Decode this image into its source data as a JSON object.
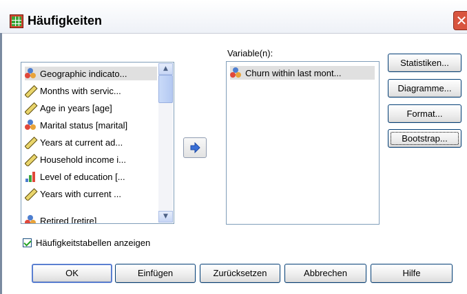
{
  "dialog": {
    "title": "Häufigkeiten",
    "close_glyph": "✕"
  },
  "source_list": {
    "items": [
      {
        "label": "Geographic indicato...",
        "icon": "nominal-icon",
        "selected": true
      },
      {
        "label": "Months with servic...",
        "icon": "scale-icon"
      },
      {
        "label": "Age in years [age]",
        "icon": "scale-icon"
      },
      {
        "label": "Marital status [marital]",
        "icon": "nominal-icon"
      },
      {
        "label": "Years at current ad...",
        "icon": "scale-icon"
      },
      {
        "label": "Household income i...",
        "icon": "scale-icon"
      },
      {
        "label": "Level of education [...",
        "icon": "ordinal-icon"
      },
      {
        "label": "Years with current ...",
        "icon": "scale-icon"
      },
      {
        "label": "Retired [retire]",
        "icon": "nominal-icon"
      }
    ]
  },
  "variables": {
    "label": "Variable(n):",
    "items": [
      {
        "label": "Churn within last mont...",
        "icon": "nominal-icon"
      }
    ]
  },
  "side_buttons": {
    "statistics": "Statistiken...",
    "charts": "Diagramme...",
    "format": "Format...",
    "bootstrap": "Bootstrap..."
  },
  "checkbox": {
    "label": "Häufigkeitstabellen anzeigen",
    "checked": true
  },
  "footer_buttons": {
    "ok": "OK",
    "paste": "Einfügen",
    "reset": "Zurücksetzen",
    "cancel": "Abbrechen",
    "help": "Hilfe"
  },
  "colors": {
    "accent": "#003c74",
    "title_bar": "#eef1f7",
    "close": "#d8553f"
  }
}
